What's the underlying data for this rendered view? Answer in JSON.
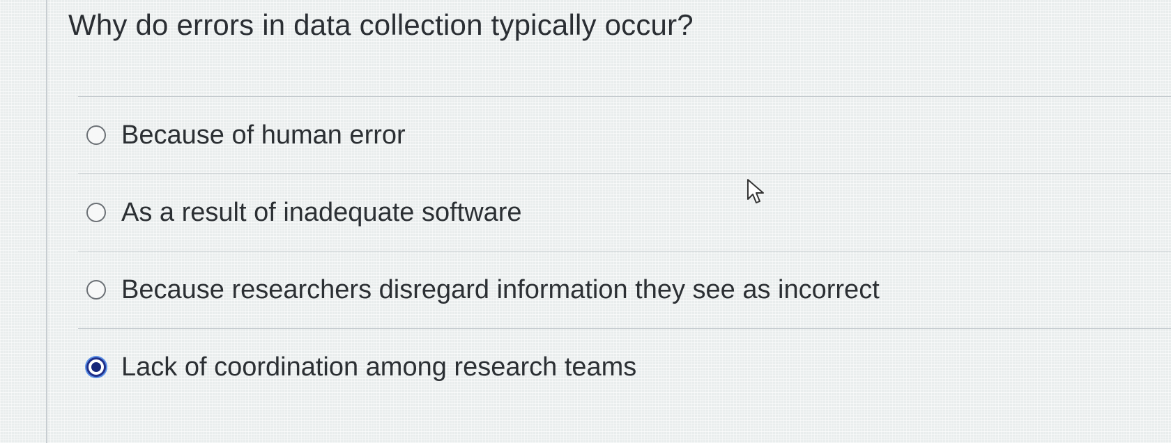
{
  "question": {
    "text": "Why do errors in data collection typically occur?"
  },
  "options": [
    {
      "label": "Because of human error",
      "selected": false
    },
    {
      "label": "As a result of inadequate software",
      "selected": false
    },
    {
      "label": "Because researchers disregard information they see as incorrect",
      "selected": false
    },
    {
      "label": "Lack of coordination among research teams",
      "selected": true
    }
  ],
  "colors": {
    "selected_radio": "#15267a",
    "focus_ring": "#5a8fe6",
    "text": "#2b2f33",
    "background": "#e9eded"
  },
  "icons": {
    "cursor": "mouse-pointer-icon"
  }
}
